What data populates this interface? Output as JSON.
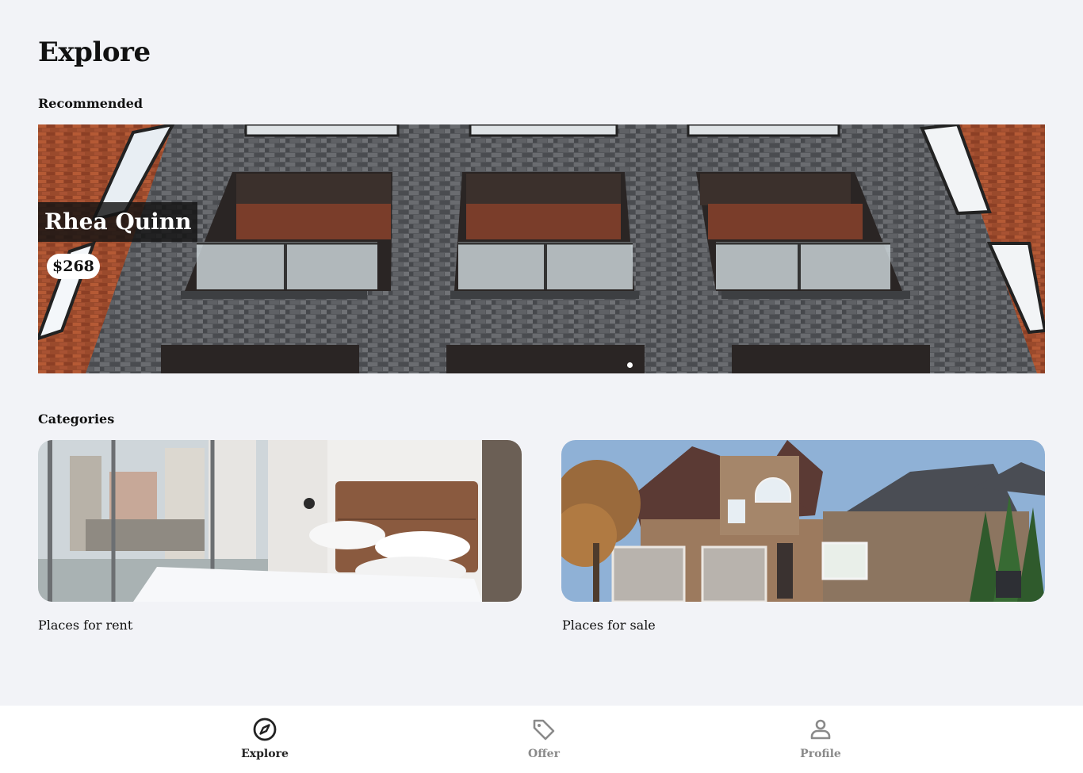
{
  "page": {
    "title": "Explore"
  },
  "recommended": {
    "section_title": "Recommended",
    "featured": {
      "name": "Rhea Quinn",
      "price": "$268"
    },
    "carousel_dots": 1,
    "active_dot": 0
  },
  "categories": {
    "section_title": "Categories",
    "items": [
      {
        "label": "Places for rent",
        "image": "bedroom-photo"
      },
      {
        "label": "Places for sale",
        "image": "house-photo"
      }
    ]
  },
  "bottom_nav": {
    "items": [
      {
        "label": "Explore",
        "icon": "compass-icon",
        "active": true
      },
      {
        "label": "Offer",
        "icon": "tag-icon",
        "active": false
      },
      {
        "label": "Profile",
        "icon": "person-icon",
        "active": false
      }
    ]
  },
  "colors": {
    "background": "#f2f3f7",
    "nav_active": "#222222",
    "nav_inactive": "#8a8a8a"
  }
}
